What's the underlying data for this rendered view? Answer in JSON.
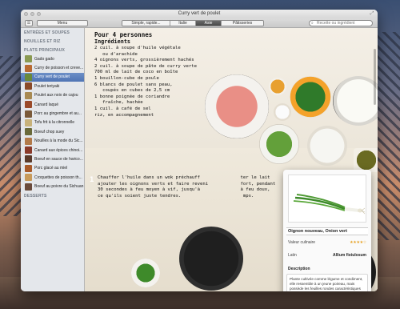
{
  "window": {
    "title": "Curry vert de poulet"
  },
  "toolbar": {
    "menu_label": "Menu",
    "segments": [
      "Simple, rapide...",
      "Italie",
      "Asie",
      "Pâtisseries"
    ],
    "active_segment": "Asie",
    "search_placeholder": "Recette ou ingrédient"
  },
  "sidebar": {
    "sections": [
      {
        "label": "ENTRÉES ET SOUPES"
      },
      {
        "label": "NOUILLES ET RIZ"
      },
      {
        "label": "PLATS PRINCIPAUX"
      },
      {
        "label": "DESSERTS"
      }
    ],
    "items": [
      {
        "label": "Gado gado",
        "color": "#8a9a52"
      },
      {
        "label": "Curry de poisson et creve...",
        "color": "#b86a32"
      },
      {
        "label": "Curry vert de poulet",
        "color": "#6a8a3a"
      },
      {
        "label": "Poulet teriyaki",
        "color": "#8a4a28"
      },
      {
        "label": "Poulet aux noix de cajou",
        "color": "#a88a52"
      },
      {
        "label": "Canard laqué",
        "color": "#9a4a2a"
      },
      {
        "label": "Porc au gingembre et au...",
        "color": "#7a5a3a"
      },
      {
        "label": "Tofu frit à la citronnelle",
        "color": "#c8b27a"
      },
      {
        "label": "Boeuf chop suey",
        "color": "#6a6a3a"
      },
      {
        "label": "Nouilles à la mode du Sic...",
        "color": "#b27a4a"
      },
      {
        "label": "Canard aux épices chinoi...",
        "color": "#8a3a2a"
      },
      {
        "label": "Boeuf en sauce de harico...",
        "color": "#5a3a2a"
      },
      {
        "label": "Porc glacé au miel",
        "color": "#a85a2a"
      },
      {
        "label": "Croquettes de poisson th...",
        "color": "#c89a5a"
      },
      {
        "label": "Boeuf au poivre du Sichuan",
        "color": "#6a4a3a"
      }
    ],
    "selected_index": 2
  },
  "recipe": {
    "title": "Pour 4 personnes",
    "subtitle": "Ingrédients",
    "ingredients": [
      "2 cuil. à soupe d'huile végétale",
      "   ou d'arachide",
      "4 oignons verts, grossièrement hachés",
      "2 cuil. à soupe de pâte de curry verte",
      "700 ml de lait de coco en boîte",
      "1 bouillon-cube de poule",
      "6 blancs de poulet sans peau,",
      "   coupés en cubes de 2,5 cm",
      "1 bonne poignée de coriandre",
      "   fraîche, hachée",
      "1 cuil. à café de sel",
      "riz, en accompagnement"
    ],
    "step_number": "1",
    "step_lines": [
      "Chauffer l'huile dans un wok préchauff               ter le lait",
      "ajouter les oignons verts et faire reveni            fort, pendant",
      "30 secondes à feu moyen à vif, jusqu'à               à feu doux,",
      "ce qu'ils soient juste tendres.                       mps."
    ]
  },
  "popover": {
    "title": "Oignon nouveau, Onion vert",
    "rows": [
      {
        "key": "Valeur culinaire",
        "value": "★★★★☆"
      },
      {
        "key": "Latin",
        "value": "Allium fistulosum"
      }
    ],
    "description_label": "Description",
    "description": "Plante cultivée comme légume et condiment, elle ressemble à un jeune poireau, mais possède les feuilles rondes caractéristiques des oignons"
  }
}
